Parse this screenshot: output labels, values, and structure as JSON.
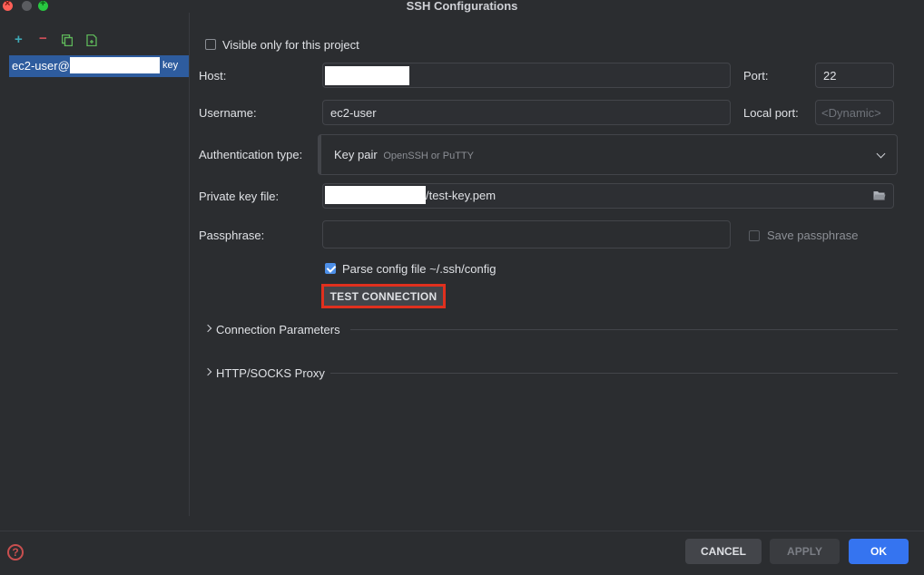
{
  "window": {
    "title": "SSH Configurations"
  },
  "toolbar": {
    "add_icon": "plus-icon",
    "remove_icon": "minus-icon",
    "copy_icon": "copy-icon",
    "import_icon": "import-file-icon"
  },
  "configs": {
    "items": [
      {
        "label_prefix": "ec2-user@",
        "label_suffix": "key"
      }
    ]
  },
  "form": {
    "visible_only_label": "Visible only for this project",
    "visible_only_checked": false,
    "host_label": "Host:",
    "host_value": "",
    "port_label": "Port:",
    "port_value": "22",
    "username_label": "Username:",
    "username_value": "ec2-user",
    "local_port_label": "Local port:",
    "local_port_placeholder": "<Dynamic>",
    "auth_label": "Authentication type:",
    "auth_value": "Key pair",
    "auth_hint": "OpenSSH or PuTTY",
    "private_key_label": "Private key file:",
    "private_key_suffix": "/test-key.pem",
    "passphrase_label": "Passphrase:",
    "save_passphrase_label": "Save passphrase",
    "parse_config_label": "Parse config file ~/.ssh/config",
    "parse_config_checked": true,
    "test_connection_label": "TEST CONNECTION"
  },
  "sections": {
    "connection_params": "Connection Parameters",
    "proxy": "HTTP/SOCKS Proxy"
  },
  "footer": {
    "cancel_label": "CANCEL",
    "apply_label": "APPLY",
    "ok_label": "OK",
    "help_glyph": "?"
  },
  "colors": {
    "accent": "#3574f0",
    "selection": "#2e5c9e",
    "highlight_border": "#e0301e"
  }
}
